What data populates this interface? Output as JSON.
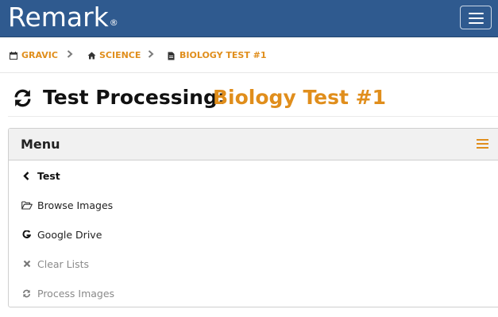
{
  "app": {
    "brand": "Remark",
    "brand_mark": "®"
  },
  "breadcrumb": [
    {
      "label": "GRAVIC",
      "icon": "calendar-icon"
    },
    {
      "label": "SCIENCE",
      "icon": "home-icon"
    },
    {
      "label": "BIOLOGY TEST #1",
      "icon": "file-icon"
    }
  ],
  "title": {
    "prefix": "Test Processing:",
    "name": "Biology Test #1",
    "icon": "refresh-icon"
  },
  "panel": {
    "title": "Menu",
    "items": [
      {
        "label": "Test",
        "icon": "chevron-left-icon",
        "state": "back"
      },
      {
        "label": "Browse Images",
        "icon": "folder-open-icon",
        "state": "enabled"
      },
      {
        "label": "Google Drive",
        "icon": "google-icon",
        "state": "enabled"
      },
      {
        "label": "Clear Lists",
        "icon": "times-icon",
        "state": "disabled"
      },
      {
        "label": "Process Images",
        "icon": "refresh-icon",
        "state": "disabled"
      }
    ]
  },
  "colors": {
    "navbar": "#2f5a8f",
    "accent": "#e08e1c",
    "disabled": "#8a8a8a"
  }
}
